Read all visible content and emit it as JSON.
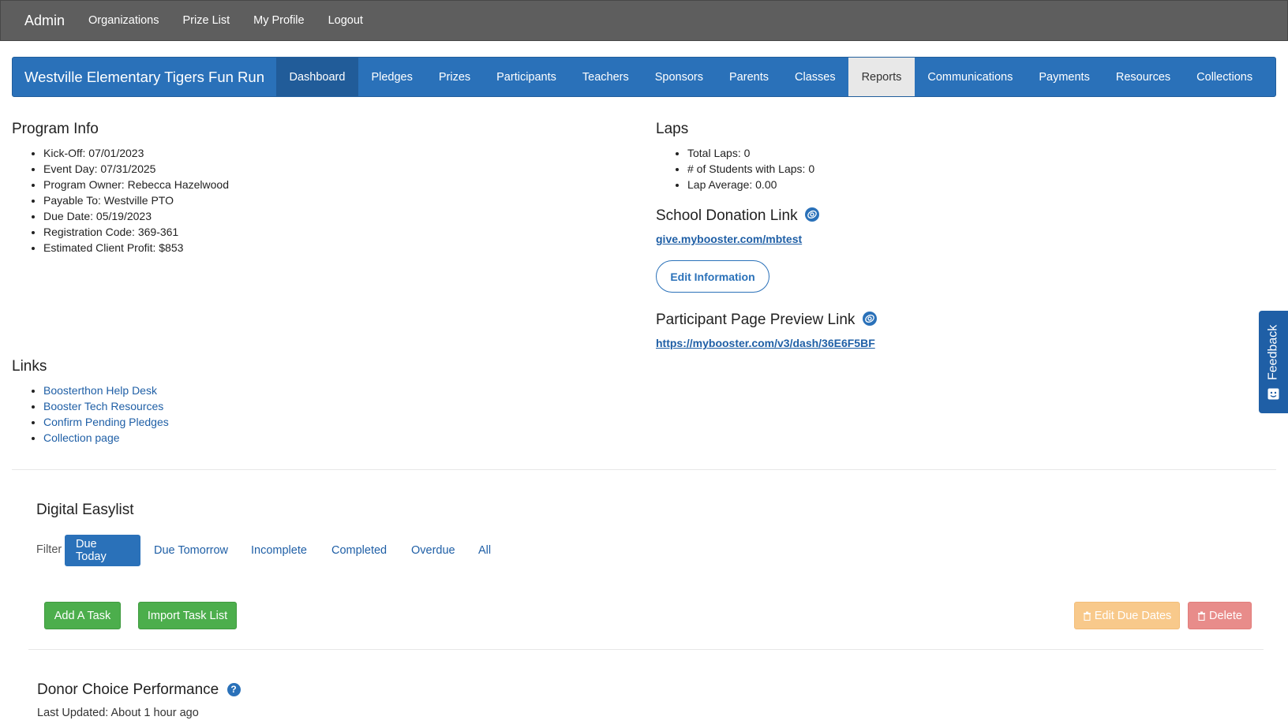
{
  "topbar": {
    "brand": "Admin",
    "links": [
      "Organizations",
      "Prize List",
      "My Profile",
      "Logout"
    ]
  },
  "program_nav": {
    "title": "Westville Elementary Tigers Fun Run",
    "tabs": [
      "Dashboard",
      "Pledges",
      "Prizes",
      "Participants",
      "Teachers",
      "Sponsors",
      "Parents",
      "Classes",
      "Reports",
      "Communications",
      "Payments",
      "Resources",
      "Collections"
    ],
    "active_tab": "Dashboard"
  },
  "program_info": {
    "title": "Program Info",
    "items": [
      "Kick-Off: 07/01/2023",
      "Event Day: 07/31/2025",
      "Program Owner: Rebecca Hazelwood",
      "Payable To: Westville PTO",
      "Due Date: 05/19/2023",
      "Registration Code: 369-361",
      "Estimated Client Profit: $853"
    ]
  },
  "laps": {
    "title": "Laps",
    "items": [
      "Total Laps: 0",
      "# of Students with Laps: 0",
      "Lap Average: 0.00"
    ]
  },
  "donation_link": {
    "title": "School Donation Link",
    "url": "give.mybooster.com/mbtest",
    "edit_button": "Edit Information"
  },
  "preview_link": {
    "title": "Participant Page Preview Link",
    "url": "https://mybooster.com/v3/dash/36E6F5BF"
  },
  "links": {
    "title": "Links",
    "items": [
      "Boosterthon Help Desk",
      "Booster Tech Resources",
      "Confirm Pending Pledges",
      "Collection page"
    ]
  },
  "easylist": {
    "title": "Digital Easylist",
    "filter_label": "Filter",
    "filters": [
      "Due Today",
      "Due Tomorrow",
      "Incomplete",
      "Completed",
      "Overdue",
      "All"
    ],
    "active_filter": "Due Today",
    "add_task": "Add A Task",
    "import_task": "Import Task List",
    "edit_due_dates": "Edit Due Dates",
    "delete": "Delete"
  },
  "donor_choice": {
    "title": "Donor Choice Performance",
    "updated": "Last Updated: About 1 hour ago"
  },
  "feedback": {
    "label": "Feedback"
  },
  "colors": {
    "topbar": "#5e5e5e",
    "primary": "#2a71b9",
    "success": "#4cae4c",
    "warning_disabled": "#f8c98b",
    "danger_disabled": "#e88c8a"
  }
}
